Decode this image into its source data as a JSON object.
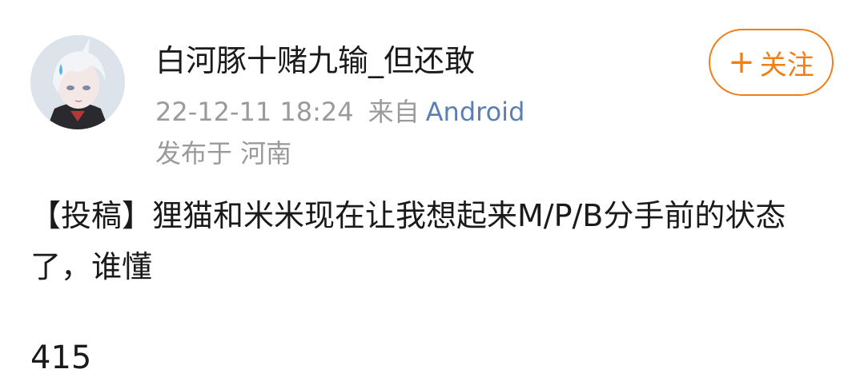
{
  "user": {
    "name": "白河豚十赌九输_但还敢",
    "avatar": "anime-avatar"
  },
  "meta": {
    "timestamp": "22-12-11 18:24",
    "source_prefix": "来自",
    "source": "Android",
    "location": "发布于 河南"
  },
  "follow_button": {
    "plus": "+",
    "label": "关注",
    "color": "#f07f17"
  },
  "post": {
    "text": "【投稿】狸猫和米米现在让我想起来M/P/B分手前的状态了，谁懂",
    "number": "415"
  },
  "colors": {
    "source_link": "#5b7fb2",
    "meta_gray": "#9a9a9a"
  }
}
